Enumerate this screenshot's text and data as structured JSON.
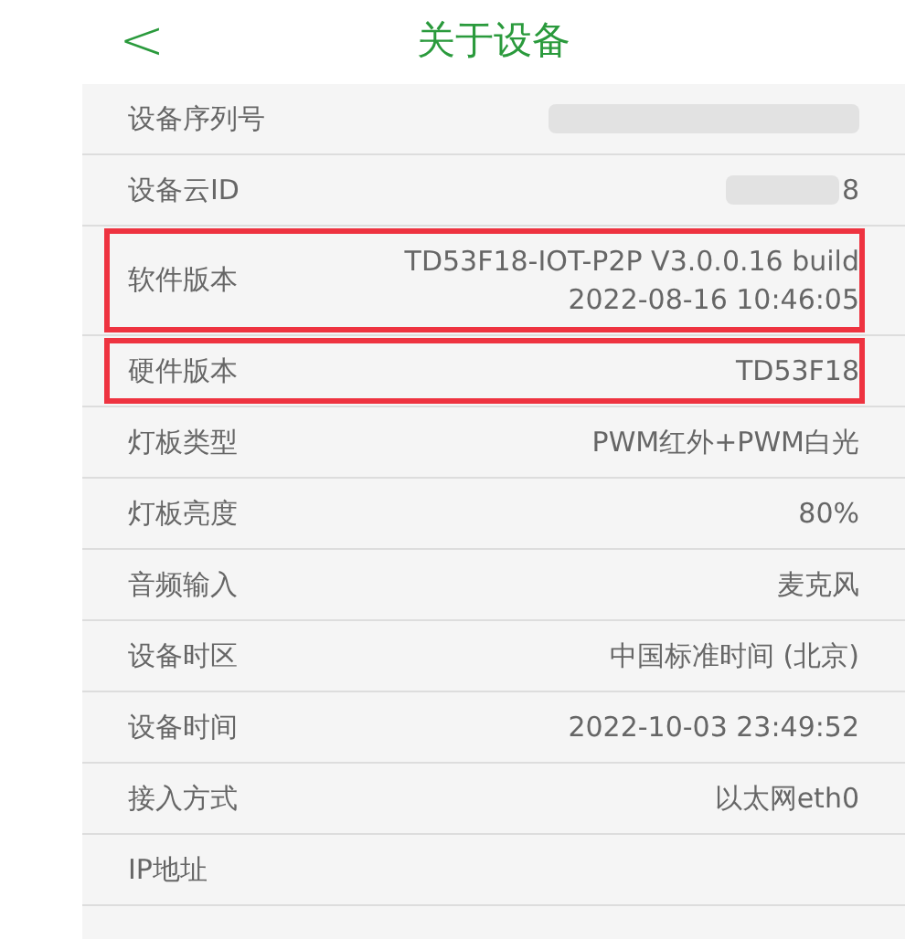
{
  "header": {
    "back": "<",
    "title": "关于设备"
  },
  "rows": [
    {
      "label": "设备序列号",
      "value": "",
      "redacted": true,
      "highlighted": false
    },
    {
      "label": "设备云ID",
      "value": "8",
      "redacted": true,
      "highlighted": false
    },
    {
      "label": "软件版本",
      "value": "TD53F18-IOT-P2P V3.0.0.16 build\n2022-08-16 10:46:05",
      "redacted": false,
      "highlighted": true
    },
    {
      "label": "硬件版本",
      "value": "TD53F18",
      "redacted": false,
      "highlighted": true
    },
    {
      "label": "灯板类型",
      "value": "PWM红外+PWM白光",
      "redacted": false,
      "highlighted": false
    },
    {
      "label": "灯板亮度",
      "value": "80%",
      "redacted": false,
      "highlighted": false
    },
    {
      "label": "音频输入",
      "value": "麦克风",
      "redacted": false,
      "highlighted": false
    },
    {
      "label": "设备时区",
      "value": "中国标准时间 (北京)",
      "redacted": false,
      "highlighted": false
    },
    {
      "label": "设备时间",
      "value": "2022-10-03 23:49:52",
      "redacted": false,
      "highlighted": false
    },
    {
      "label": "接入方式",
      "value": "以太网eth0",
      "redacted": false,
      "highlighted": false
    },
    {
      "label": "IP地址",
      "value": "",
      "redacted": false,
      "highlighted": false
    }
  ]
}
